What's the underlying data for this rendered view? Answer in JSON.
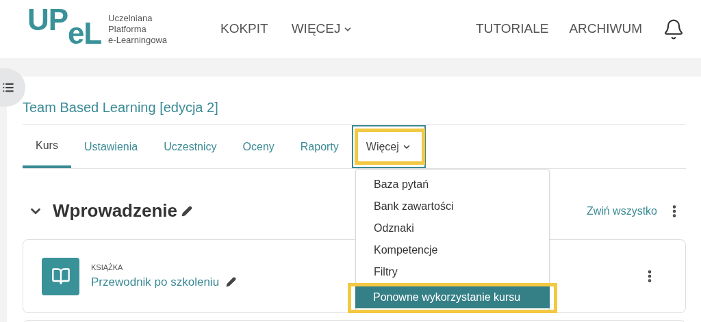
{
  "header": {
    "logo_mark": [
      "UP",
      "eL"
    ],
    "logo_text": [
      "Uczelniana",
      "Platforma",
      "e-Learningowa"
    ],
    "nav": [
      {
        "label": "KOKPIT",
        "kind": "link"
      },
      {
        "label": "WIĘCEJ",
        "kind": "dropdown"
      }
    ],
    "nav_right": [
      "TUTORIALE",
      "ARCHIWUM"
    ]
  },
  "course": {
    "title": "Team Based Learning [edycja 2]",
    "tabs": [
      {
        "label": "Kurs",
        "selected": true,
        "kind": "link",
        "expanded": false
      },
      {
        "label": "Ustawienia",
        "selected": false,
        "kind": "link",
        "expanded": false
      },
      {
        "label": "Uczestnicy",
        "selected": false,
        "kind": "link",
        "expanded": false
      },
      {
        "label": "Oceny",
        "selected": false,
        "kind": "link",
        "expanded": false
      },
      {
        "label": "Raporty",
        "selected": false,
        "kind": "link",
        "expanded": false
      },
      {
        "label": "Więcej",
        "selected": false,
        "kind": "dropdown",
        "expanded": true
      }
    ],
    "menu": [
      {
        "label": "Baza pytań",
        "selected": false
      },
      {
        "label": "Bank zawartości",
        "selected": false
      },
      {
        "label": "Odznaki",
        "selected": false
      },
      {
        "label": "Kompetencje",
        "selected": false
      },
      {
        "label": "Filtry",
        "selected": false
      },
      {
        "label": "Ponowne wykorzystanie kursu",
        "selected": true
      }
    ],
    "section": {
      "title": "Wprowadzenie",
      "collapse_all": "Zwiń wszystko"
    },
    "activity": {
      "type": "KSIĄŻKA",
      "name": "Przewodnik po szkoleniu"
    }
  }
}
